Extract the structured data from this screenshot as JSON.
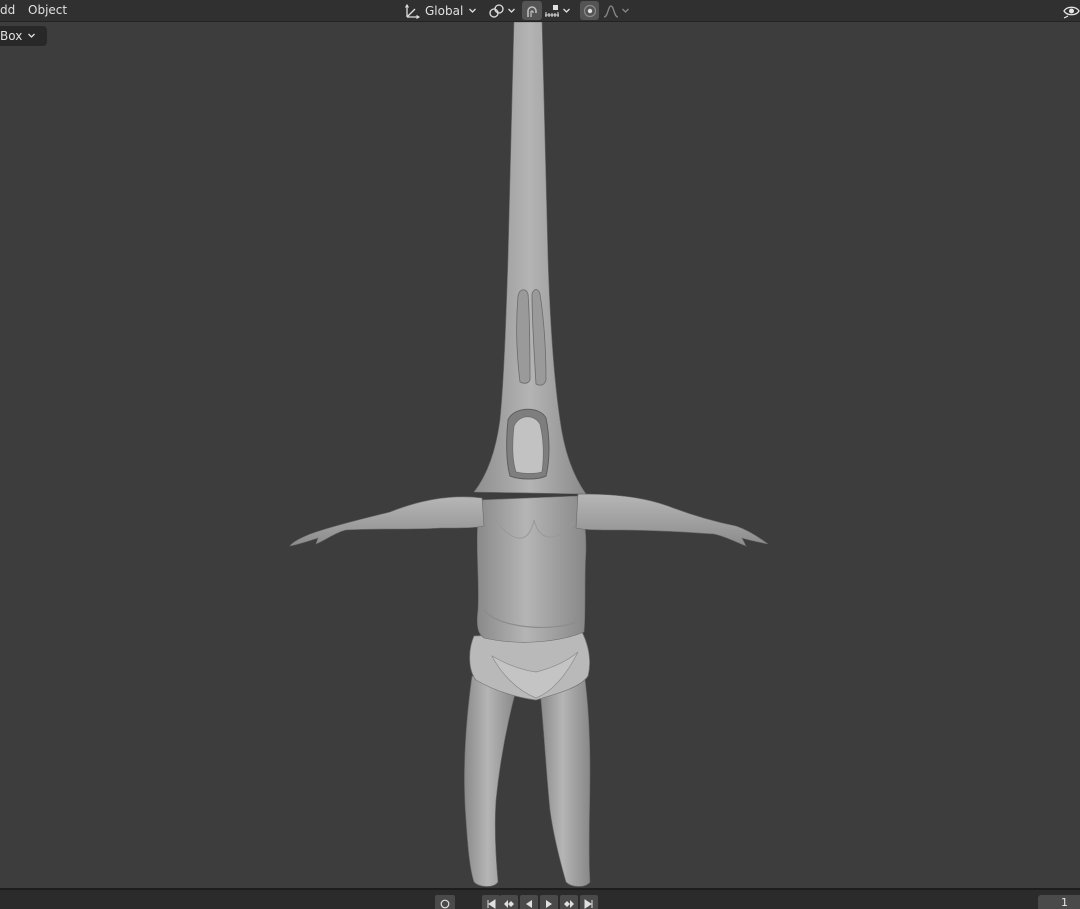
{
  "header": {
    "menus": [
      {
        "label": "dd"
      },
      {
        "label": "Object"
      }
    ],
    "transform_orientation": {
      "label": "Global",
      "icon": "transform-orientation-icon"
    },
    "pivot_icon": "pivot-point-icon",
    "snap_icon": "snap-magnet-icon",
    "snap_target_icon": "snap-increment-icon",
    "proportional_icon": "proportional-editing-icon",
    "falloff_icon": "falloff-curve-icon",
    "visibility_icon": "eye-icon"
  },
  "viewport": {
    "select_mode": {
      "label": "Box"
    }
  },
  "timeline": {
    "current_frame": "1"
  },
  "colors": {
    "background": "#3d3d3d",
    "header": "#303030",
    "model": "#a9a9a9"
  }
}
